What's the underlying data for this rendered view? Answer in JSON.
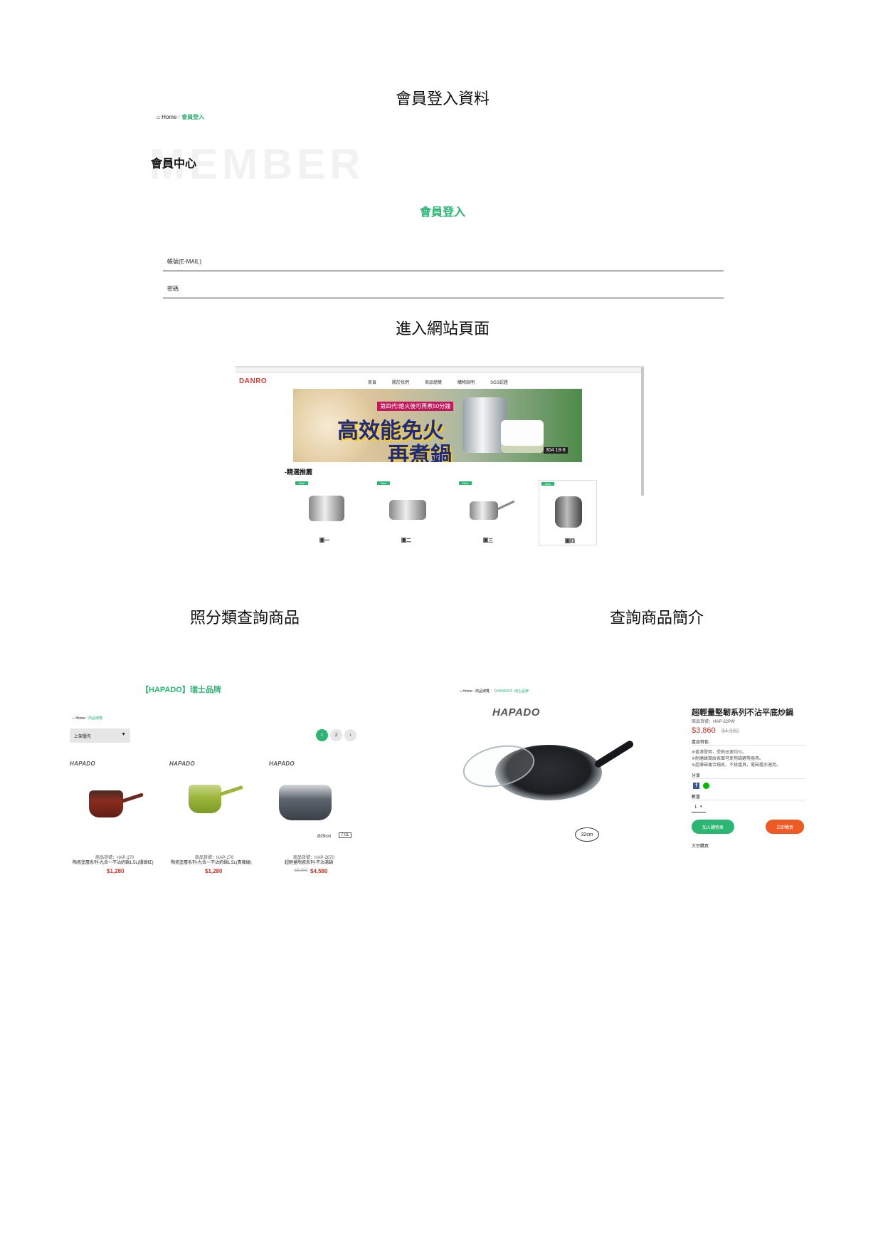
{
  "section_titles": {
    "login": "會員登入資料",
    "site": "進入網站頁面",
    "category": "照分類查詢商品",
    "detail": "查詢商品簡介"
  },
  "login": {
    "breadcrumb_home": "Home",
    "breadcrumb_current": "會員登入",
    "watermark": "MEMBER",
    "page_title": "會員中心",
    "form_title": "會員登入",
    "email_label": "帳號(E-MAIL)",
    "password_label": "密碼"
  },
  "site": {
    "logo": "DANRO",
    "nav": [
      "首頁",
      "關於我們",
      "商品總覽",
      "購物說明",
      "SGS認證"
    ],
    "banner": {
      "line1": "第四代!熄火後可再煮50分鐘",
      "main1": "高效能免火",
      "main2": "再煮鍋",
      "badge": "304 18-8"
    },
    "section_label": "-精選推薦",
    "new_badge": "New",
    "products": [
      "圖一",
      "圖二",
      "圖三",
      "圖四"
    ]
  },
  "category": {
    "brand_title": "【HAPADO】瑞士品牌",
    "breadcrumb_home": "Home",
    "breadcrumb_current": "商品總覽",
    "sort_label": "上架優先",
    "pages": [
      "1",
      "2",
      "›"
    ],
    "brand_logo": "HAPADO",
    "products": [
      {
        "code": "商品貨號：HAP-170",
        "name": "陶瓷塗層系列-九合一不沾奶鍋1.5L(珊瑚紅)",
        "old_price": "",
        "price": "$1,280",
        "color": "#8b2c1f"
      },
      {
        "code": "商品貨號：HAP-178",
        "name": "陶瓷塗層系列-九合一不沾奶鍋1.5L(青蘋綠)",
        "old_price": "",
        "price": "$1,280",
        "color": "#9bb63a"
      },
      {
        "code": "商品貨號：HAP-2670",
        "name": "超輕量陶瓷系列-不沾湯鍋",
        "old_price": "$5,880",
        "price": "$4,580",
        "color": "#5f6670"
      }
    ],
    "pot_sizes": [
      "Ø29cm",
      "7.0L"
    ]
  },
  "detail": {
    "breadcrumb": [
      "Home",
      "商品總覽",
      "【HAPADO】瑞士品牌"
    ],
    "brand_logo": "HAPADO",
    "title": "超輕量堅韌系列不沾平底炒鍋",
    "code": "商品貨號：HAP-32PW",
    "price": "$3,860",
    "old_price": "$4,980",
    "features_label": "產品特色",
    "features": [
      "※香港發明，受熱迅速均勻。",
      "※耐磨蜂窩紋表面可使用鍋鏟等器具。",
      "※超導磁複合鍋底，不挑爐具，電磁爐亦適用。"
    ],
    "share_label": "分享",
    "qty_label": "數量",
    "qty_value": "1",
    "add_cart": "加入購物車",
    "buy_now": "立即購買",
    "bulk": "大宗購買",
    "size_badge": "32cm"
  },
  "colors": {
    "accent": "#2bb673",
    "buy": "#ee5a24",
    "price": "#c0392b"
  }
}
